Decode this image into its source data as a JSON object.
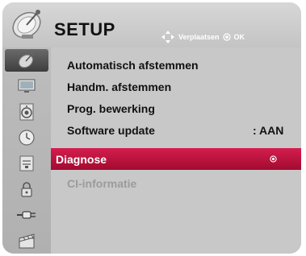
{
  "header": {
    "title": "SETUP",
    "hint_move": "Verplaatsen",
    "hint_ok": "OK"
  },
  "sidebar": {
    "items": [
      {
        "icon": "satellite-dish-icon",
        "active": true
      },
      {
        "icon": "monitor-icon",
        "active": false
      },
      {
        "icon": "speaker-icon",
        "active": false
      },
      {
        "icon": "clock-icon",
        "active": false
      },
      {
        "icon": "lock-panel-icon",
        "active": false
      },
      {
        "icon": "padlock-icon",
        "active": false
      },
      {
        "icon": "connector-icon",
        "active": false
      },
      {
        "icon": "clapperboard-icon",
        "active": false
      }
    ]
  },
  "menu": {
    "items": [
      {
        "label": "Automatisch afstemmen",
        "value": ""
      },
      {
        "label": "Handm. afstemmen",
        "value": ""
      },
      {
        "label": "Prog. bewerking",
        "value": ""
      },
      {
        "label": "Software update",
        "value": ": AAN"
      },
      {
        "label": "Diagnose",
        "value": "",
        "selected": true
      },
      {
        "label": "CI-informatie",
        "value": "",
        "disabled": true
      }
    ]
  },
  "colors": {
    "highlight": "#c4173f",
    "panel": "#c8c8c8",
    "disabled_text": "#9b9b9b"
  }
}
